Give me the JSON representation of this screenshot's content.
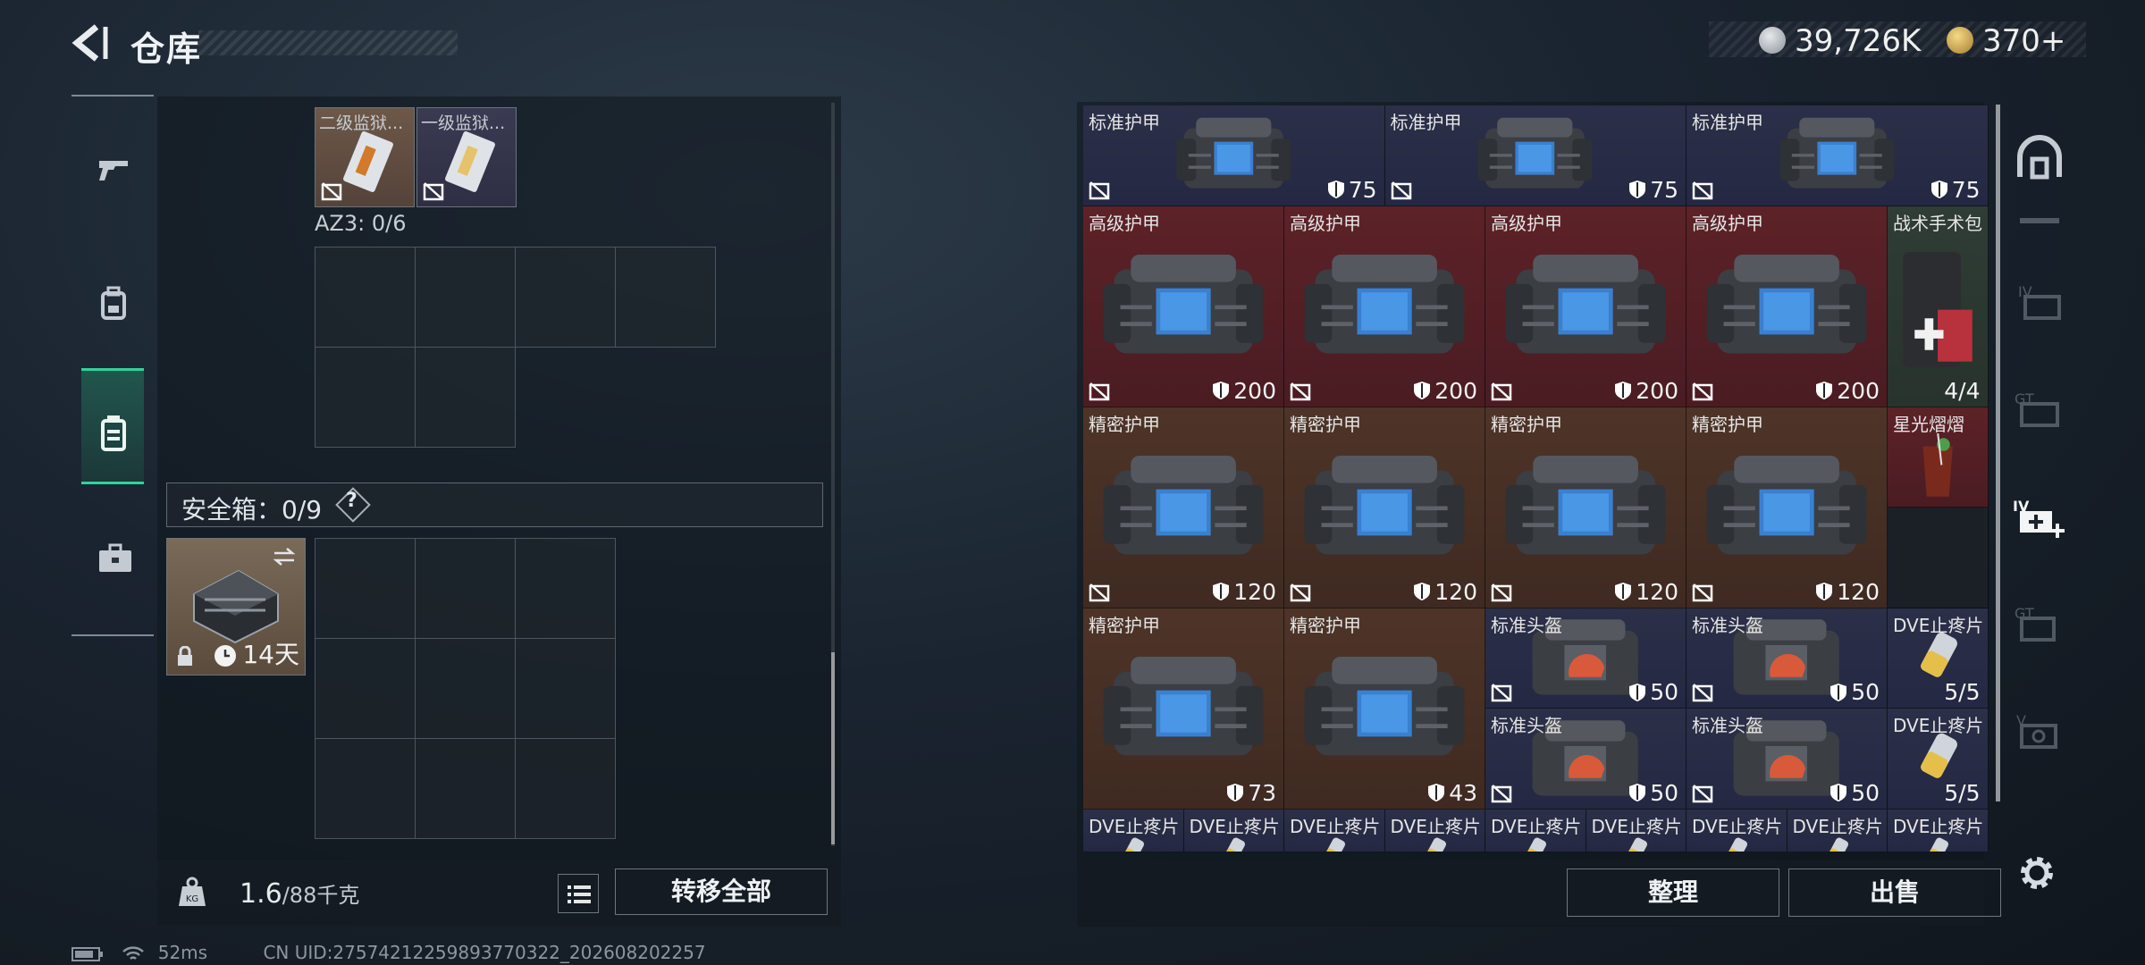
{
  "header": {
    "title": "仓库",
    "currency_a": "39,726K",
    "currency_b": "370+"
  },
  "left": {
    "top_items": [
      {
        "label": "二级监狱..."
      },
      {
        "label": "一级监狱..."
      }
    ],
    "container_label": "AZ3: 0/6",
    "safebox_label": "安全箱：0/9",
    "help_glyph": "?",
    "safebox_days": "14天",
    "weight_value": "1.6",
    "weight_max": "/88千克",
    "transfer_all": "转移全部"
  },
  "grid_items": {
    "r1": [
      {
        "name": "标准护甲",
        "value": "75"
      },
      {
        "name": "标准护甲",
        "value": "75"
      },
      {
        "name": "标准护甲",
        "value": "75"
      }
    ],
    "r2": [
      {
        "name": "高级护甲",
        "value": "200"
      },
      {
        "name": "高级护甲",
        "value": "200"
      },
      {
        "name": "高级护甲",
        "value": "200"
      },
      {
        "name": "高级护甲",
        "value": "200"
      }
    ],
    "medkit": {
      "name": "战术手术包",
      "value": "4/4"
    },
    "drink": {
      "name": "星光熠熠"
    },
    "r3": [
      {
        "name": "精密护甲",
        "value": "120"
      },
      {
        "name": "精密护甲",
        "value": "120"
      },
      {
        "name": "精密护甲",
        "value": "120"
      },
      {
        "name": "精密护甲",
        "value": "120"
      }
    ],
    "r4": [
      {
        "name": "精密护甲",
        "value": "73"
      },
      {
        "name": "精密护甲",
        "value": "43"
      }
    ],
    "helmets": [
      {
        "name": "标准头盔",
        "value": "50"
      },
      {
        "name": "标准头盔",
        "value": "50"
      },
      {
        "name": "标准头盔",
        "value": "50"
      },
      {
        "name": "标准头盔",
        "value": "50"
      }
    ],
    "painkillers_big": [
      {
        "name": "DVE止疼片",
        "value": "5/5"
      },
      {
        "name": "DVE止疼片",
        "value": "5/5"
      }
    ],
    "painkillers_row": [
      {
        "name": "DVE止疼片"
      },
      {
        "name": "DVE止疼片"
      },
      {
        "name": "DVE止疼片"
      },
      {
        "name": "DVE止疼片"
      },
      {
        "name": "DVE止疼片"
      },
      {
        "name": "DVE止疼片"
      },
      {
        "name": "DVE止疼片"
      },
      {
        "name": "DVE止疼片"
      },
      {
        "name": "DVE止疼片"
      }
    ]
  },
  "footer": {
    "sort": "整理",
    "sell": "出售"
  },
  "status": {
    "ping": "52ms",
    "uid": "CN UID:27574212259893770322_202608202257"
  },
  "colors": {
    "accent_green": "#2fd39a",
    "tier_blue": "#2b2f48",
    "tier_red": "#5c2228",
    "tier_brown": "#4e3428"
  }
}
